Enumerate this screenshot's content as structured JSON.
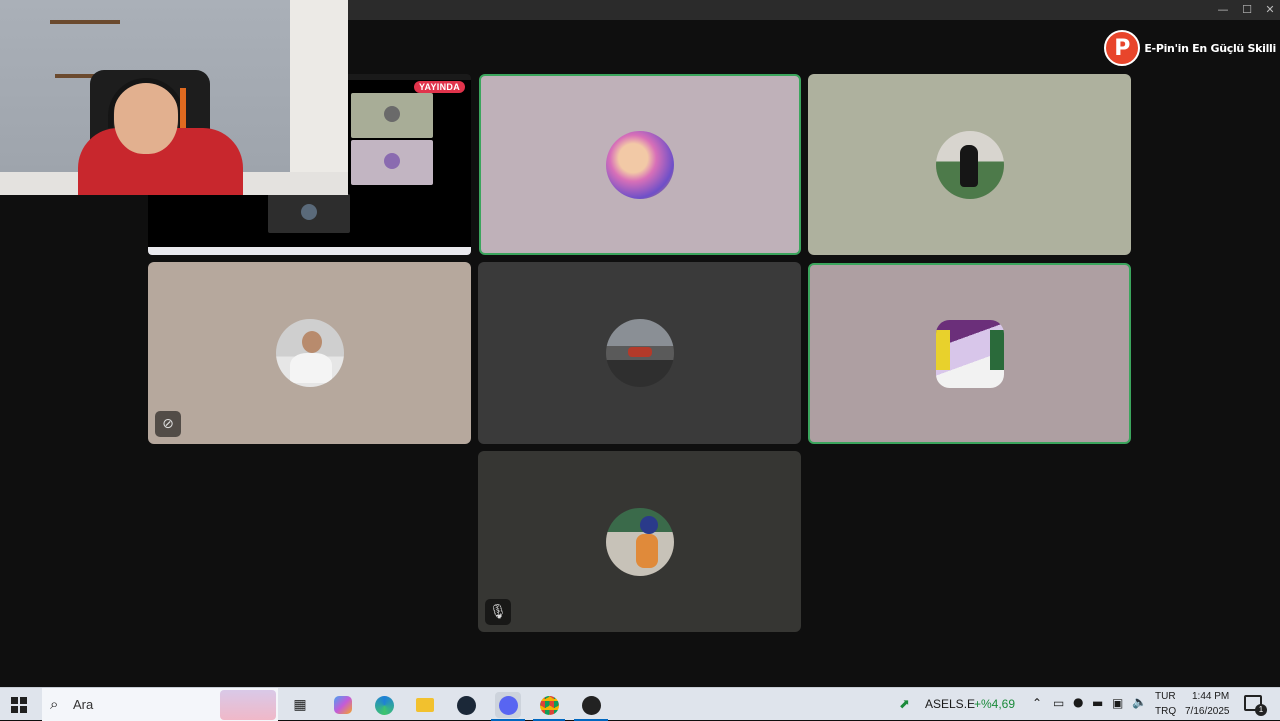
{
  "window": {
    "minimize": "—",
    "maximize": "☐",
    "close": "✕"
  },
  "brand": {
    "logo_letter": "P",
    "text": "E-Pin'in En Güçlü Skilli"
  },
  "stream": {
    "live_badge": "YAYINDA"
  },
  "tiles": [
    {
      "id": "tile-1",
      "bg": "#bfb1b9",
      "speaking": true
    },
    {
      "id": "tile-2",
      "bg": "#aeb19e",
      "speaking": false
    },
    {
      "id": "tile-3",
      "bg": "#b6a89d",
      "speaking": false,
      "status_icon": "camera-off-icon"
    },
    {
      "id": "tile-4",
      "bg": "#3a3a3a",
      "speaking": false
    },
    {
      "id": "tile-5",
      "bg": "#ae9fa2",
      "speaking": true
    },
    {
      "id": "tile-6",
      "bg": "#363633",
      "speaking": false,
      "status_icon": "mic-muted-icon"
    }
  ],
  "taskbar": {
    "search_placeholder": "Ara",
    "stock_symbol": "ASELS.E",
    "stock_change": "+%4,69",
    "lang_top": "TUR",
    "lang_bottom": "TRQ",
    "time": "1:44 PM",
    "date": "7/16/2025",
    "notification_count": "1"
  },
  "colors": {
    "speaking_border": "#3ba55d",
    "live_red": "#e0334b",
    "stock_green": "#1a8a3a"
  }
}
